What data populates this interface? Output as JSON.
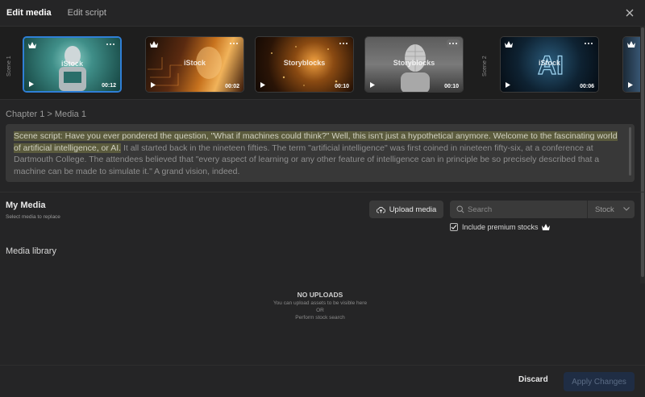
{
  "tabs": [
    {
      "label": "Edit media",
      "active": true
    },
    {
      "label": "Edit script",
      "active": false
    }
  ],
  "icons": {
    "close": "close-icon",
    "crown": "crown-icon",
    "more": "more-icon",
    "play": "play-icon",
    "upload": "cloud-upload-icon",
    "search": "search-icon",
    "chevron": "chevron-down-icon",
    "check": "check-icon"
  },
  "strip": {
    "scenes": [
      {
        "label": "Scene 1"
      },
      {
        "label": "Scene 2"
      }
    ],
    "thumbnails": [
      {
        "watermark": "iStock",
        "duration": "00:12",
        "premium": true,
        "selected": true
      },
      {
        "watermark": "iStock",
        "duration": "00:02",
        "premium": true,
        "selected": false
      },
      {
        "watermark": "Storyblocks",
        "duration": "00:10",
        "premium": false,
        "selected": false
      },
      {
        "watermark": "Storyblocks",
        "duration": "00:10",
        "premium": false,
        "selected": false
      },
      {
        "watermark": "iStock",
        "duration": "00:06",
        "premium": true,
        "selected": false
      }
    ]
  },
  "breadcrumb": "Chapter 1 > Media 1",
  "script": {
    "highlighted": "Scene script: Have you ever pondered the question, \"What if machines could think?\" Well, this isn't just a hypothetical anymore. Welcome to the fascinating world of artificial intelligence, or AI.",
    "rest": " It all started back in the nineteen fifties. The term \"artificial intelligence\" was first coined in nineteen fifty-six, at a conference at Dartmouth College. The attendees believed that \"every aspect of learning or any other feature of intelligence can in principle be so precisely described that a machine can be made to simulate it.\" A grand vision, indeed."
  },
  "my_media": {
    "title": "My Media",
    "subtitle": "Select media to replace",
    "upload_label": "Upload media"
  },
  "search": {
    "placeholder": "Search",
    "source": "Stock"
  },
  "premium": {
    "label": "Include premium stocks",
    "checked": true
  },
  "library": {
    "title": "Media library",
    "empty_title": "NO UPLOADS",
    "empty_line1": "You can upload assets to be visible here",
    "empty_or": "OR",
    "empty_line2": "Perform stock search"
  },
  "footer": {
    "discard": "Discard",
    "apply": "Apply Changes"
  },
  "colors": {
    "background": "#252526",
    "selected_border": "#2f7fd6",
    "highlight": "#5b5b3d",
    "apply_bg": "#1f2d44"
  }
}
